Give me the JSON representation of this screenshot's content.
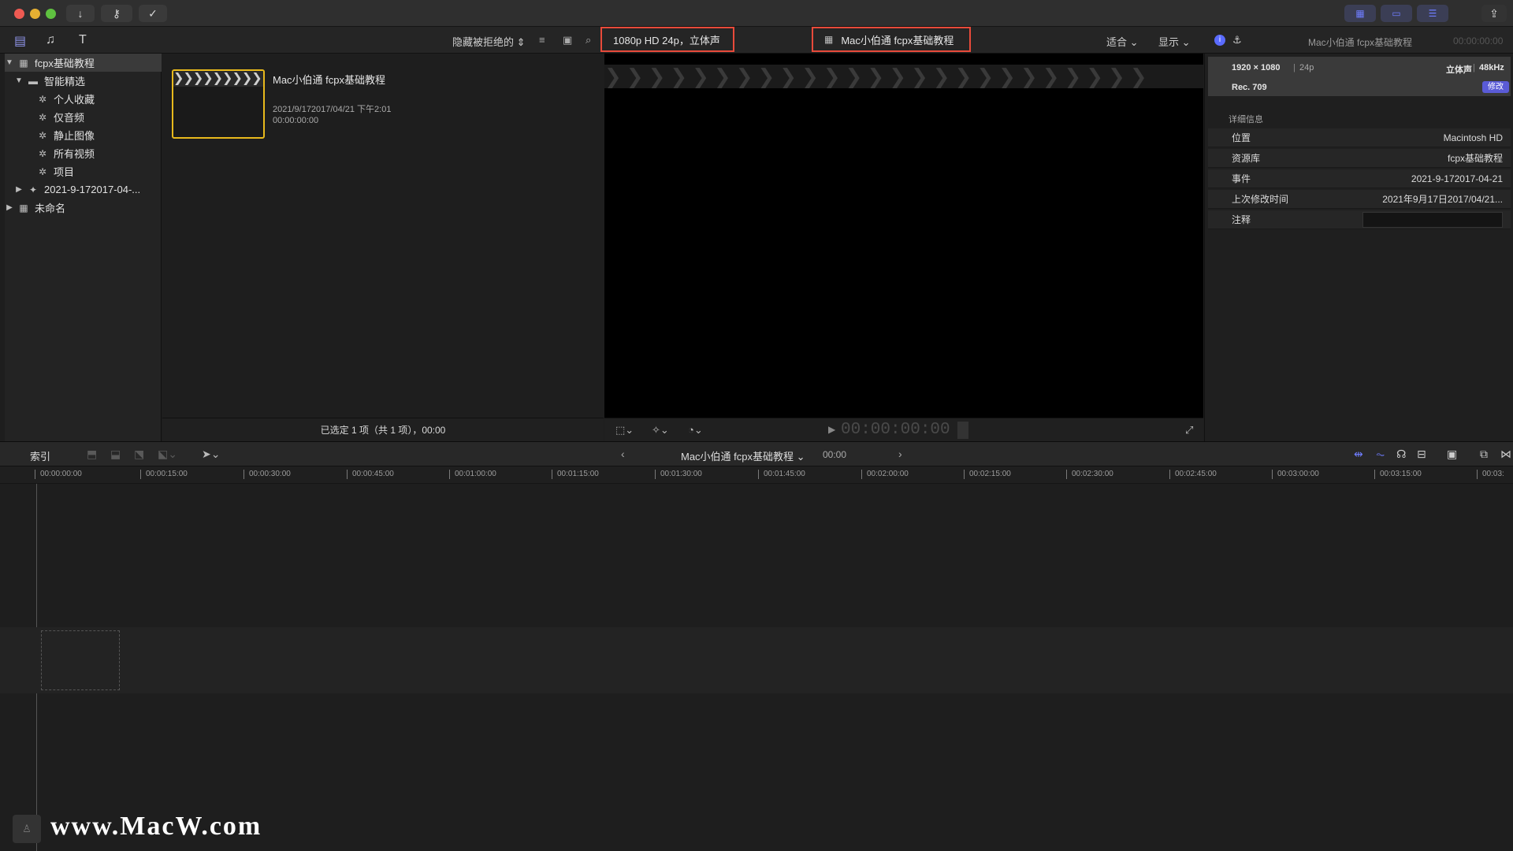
{
  "browser_toolbar": {
    "filter_label": "隐藏被拒绝的",
    "format_label": "1080p HD 24p，立体声"
  },
  "viewer_toolbar": {
    "project_title": "Mac小伯通 fcpx基础教程",
    "fit_label": "适合",
    "view_label": "显示",
    "timecode": "00:00:00:00"
  },
  "sidebar": {
    "library": "fcpx基础教程",
    "smart_folder": "智能精选",
    "items": [
      "个人收藏",
      "仅音频",
      "静止图像",
      "所有视频",
      "项目"
    ],
    "event": "2021-9-172017-04-...",
    "untitled": "未命名"
  },
  "browser": {
    "clip": {
      "title": "Mac小伯通 fcpx基础教程",
      "date": "2021/9/172017/04/21 下午2:01",
      "duration": "00:00:00:00"
    },
    "status": "已选定 1 项（共 1 项），00:00"
  },
  "inspector": {
    "header_title": "Mac小伯通 fcpx基础教程",
    "header_time": "00:00:00:00",
    "resolution": "1920 × 1080",
    "framerate": "24p",
    "audio": "立体声",
    "samplerate": "48kHz",
    "colorspace": "Rec. 709",
    "modify_button": "修改",
    "section_title": "详细信息",
    "rows": [
      {
        "label": "位置",
        "value": "Macintosh HD"
      },
      {
        "label": "资源库",
        "value": "fcpx基础教程"
      },
      {
        "label": "事件",
        "value": "2021-9-172017-04-21"
      },
      {
        "label": "上次修改时间",
        "value": "2021年9月17日2017/04/21..."
      },
      {
        "label": "注释",
        "value": ""
      }
    ]
  },
  "timeline_toolbar": {
    "index_label": "索引",
    "project_title": "Mac小伯通 fcpx基础教程",
    "duration": "00:00"
  },
  "ruler": {
    "ticks": [
      "00:00:00:00",
      "00:00:15:00",
      "00:00:30:00",
      "00:00:45:00",
      "00:01:00:00",
      "00:01:15:00",
      "00:01:30:00",
      "00:01:45:00",
      "00:02:00:00",
      "00:02:15:00",
      "00:02:30:00",
      "00:02:45:00",
      "00:03:00:00",
      "00:03:15:00",
      "00:03:"
    ]
  },
  "watermark": "www.MacW.com",
  "colors": {
    "accent": "#6f7dff",
    "highlight_box": "#e84a3a",
    "selection_yellow": "#e8b91c"
  }
}
